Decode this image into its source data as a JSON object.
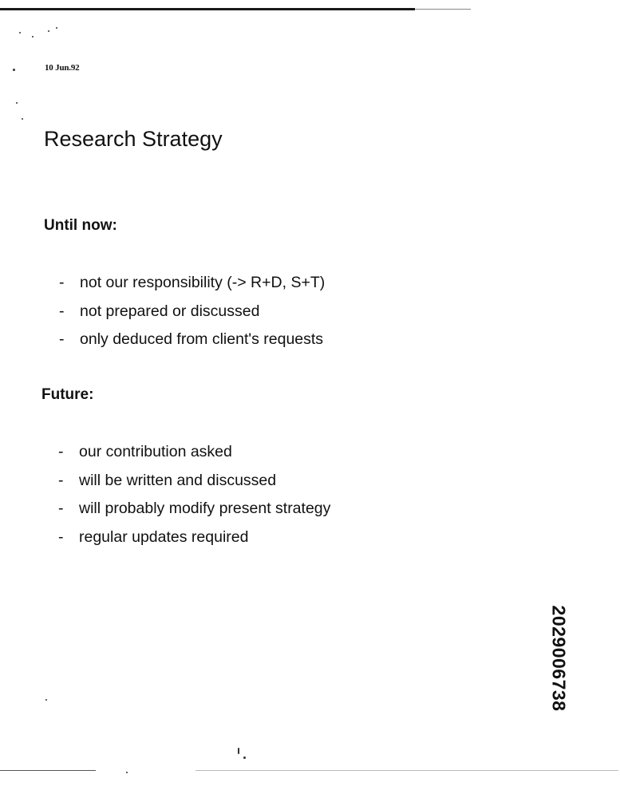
{
  "header": {
    "date": "10 Jun.92"
  },
  "title": "Research Strategy",
  "sections": {
    "until_now": {
      "heading": "Until now:",
      "items": [
        "not our responsibility (-> R+D, S+T)",
        "not prepared or discussed",
        "only deduced from client's requests"
      ]
    },
    "future": {
      "heading": "Future:",
      "items": [
        "our contribution asked",
        "will be written and discussed",
        "will probably modify present strategy",
        "regular updates required"
      ]
    }
  },
  "bullet_marker": "-",
  "document_number": "2029006738"
}
